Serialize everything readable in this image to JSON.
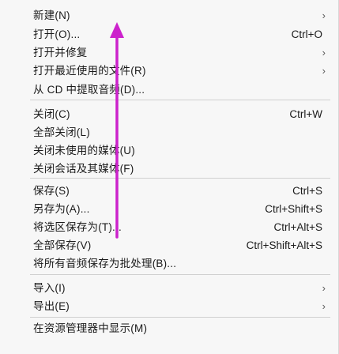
{
  "menu": {
    "items": [
      {
        "label": "新建(N)",
        "shortcut": "",
        "submenu": true
      },
      {
        "label": "打开(O)...",
        "shortcut": "Ctrl+O",
        "submenu": false
      },
      {
        "label": "打开并修复",
        "shortcut": "",
        "submenu": true
      },
      {
        "label": "打开最近使用的文件(R)",
        "shortcut": "",
        "submenu": true
      },
      {
        "label": "从 CD 中提取音频(D)...",
        "shortcut": "",
        "submenu": false
      },
      {
        "label": "关闭(C)",
        "shortcut": "Ctrl+W",
        "submenu": false
      },
      {
        "label": "全部关闭(L)",
        "shortcut": "",
        "submenu": false
      },
      {
        "label": "关闭未使用的媒体(U)",
        "shortcut": "",
        "submenu": false
      },
      {
        "label": "关闭会话及其媒体(F)",
        "shortcut": "",
        "submenu": false
      },
      {
        "label": "保存(S)",
        "shortcut": "Ctrl+S",
        "submenu": false
      },
      {
        "label": "另存为(A)...",
        "shortcut": "Ctrl+Shift+S",
        "submenu": false
      },
      {
        "label": "将选区保存为(T)...",
        "shortcut": "Ctrl+Alt+S",
        "submenu": false
      },
      {
        "label": "全部保存(V)",
        "shortcut": "Ctrl+Shift+Alt+S",
        "submenu": false
      },
      {
        "label": "将所有音频保存为批处理(B)...",
        "shortcut": "",
        "submenu": false
      },
      {
        "label": "导入(I)",
        "shortcut": "",
        "submenu": true
      },
      {
        "label": "导出(E)",
        "shortcut": "",
        "submenu": true
      },
      {
        "label": "在资源管理器中显示(M)",
        "shortcut": "",
        "submenu": false
      }
    ]
  },
  "colors": {
    "menu_background": "#f7f7f7",
    "text": "#1a1a1a",
    "annotation_arrow": "#cc22cc"
  },
  "icons": {
    "submenu": "chevron-right-icon",
    "annotation": "up-arrow-icon"
  }
}
